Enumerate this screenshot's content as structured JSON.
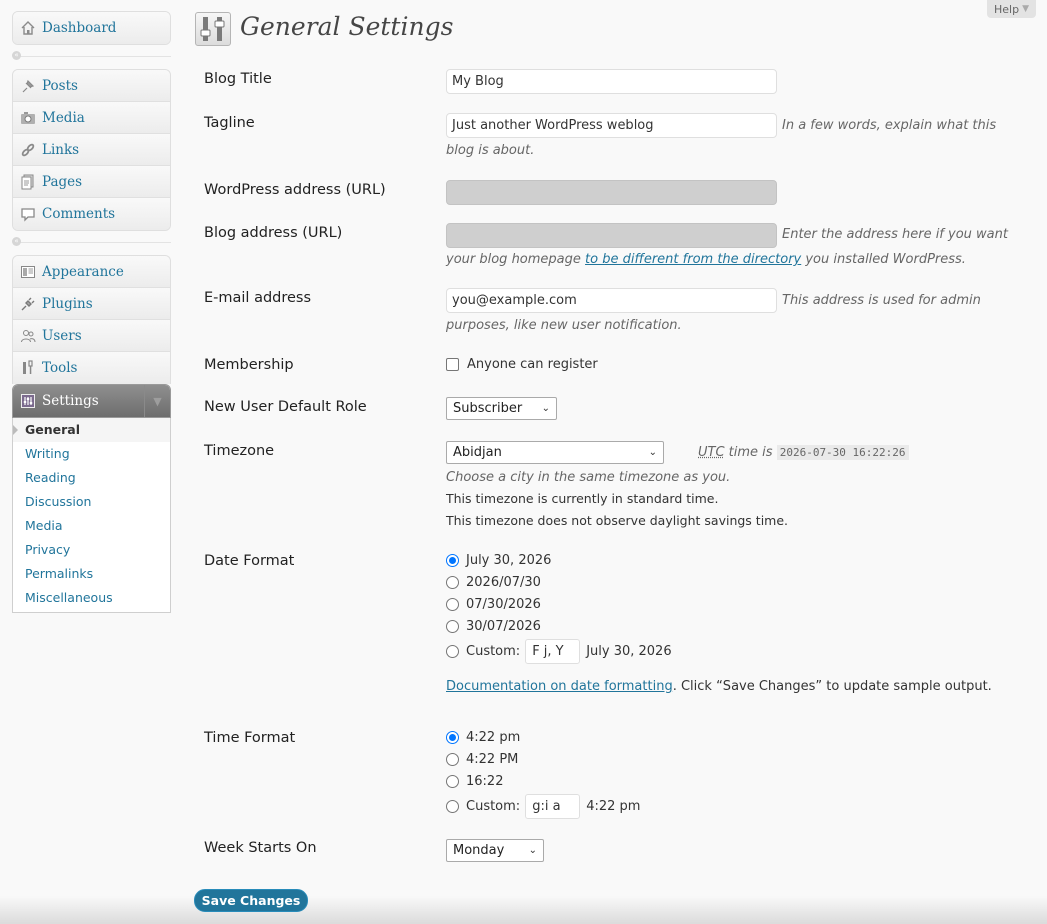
{
  "help": {
    "label": "Help"
  },
  "sidebar": {
    "group1": [
      {
        "label": "Dashboard",
        "icon": "house-icon"
      }
    ],
    "group2": [
      {
        "label": "Posts",
        "icon": "pushpin-icon"
      },
      {
        "label": "Media",
        "icon": "camera-icon"
      },
      {
        "label": "Links",
        "icon": "chain-link-icon"
      },
      {
        "label": "Pages",
        "icon": "pages-icon"
      },
      {
        "label": "Comments",
        "icon": "speech-bubble-icon"
      }
    ],
    "group3": [
      {
        "label": "Appearance",
        "icon": "layout-icon"
      },
      {
        "label": "Plugins",
        "icon": "plug-icon"
      },
      {
        "label": "Users",
        "icon": "users-icon"
      },
      {
        "label": "Tools",
        "icon": "tools-icon"
      }
    ],
    "settings": {
      "label": "Settings",
      "icon": "settings-icon"
    },
    "submenu": [
      "General",
      "Writing",
      "Reading",
      "Discussion",
      "Media",
      "Privacy",
      "Permalinks",
      "Miscellaneous"
    ]
  },
  "page": {
    "title": "General Settings"
  },
  "form": {
    "blog_title": {
      "label": "Blog Title",
      "value": "My Blog"
    },
    "tagline": {
      "label": "Tagline",
      "value": "Just another WordPress weblog",
      "desc_line1": "In a few words, explain what this",
      "desc_line2": "blog is about."
    },
    "wp_address": {
      "label": "WordPress address (URL)",
      "value": ""
    },
    "blog_address": {
      "label": "Blog address (URL)",
      "value": "",
      "desc_line1": "Enter the address here if you want",
      "desc_line2_pre": "your blog homepage ",
      "desc_link": "to be different from the directory",
      "desc_line2_post": " you installed WordPress."
    },
    "email": {
      "label": "E-mail address",
      "value": "you@example.com",
      "desc_line1": "This address is used for admin",
      "desc_line2": "purposes, like new user notification."
    },
    "membership": {
      "label": "Membership",
      "checkbox_label": "Anyone can register",
      "checked": false
    },
    "default_role": {
      "label": "New User Default Role",
      "value": "Subscriber"
    },
    "timezone": {
      "label": "Timezone",
      "value": "Abidjan",
      "utc_abbr": "UTC",
      "utc_text": " time is ",
      "utc_time": "2026-07-30 16:22:26",
      "desc": "Choose a city in the same timezone as you.",
      "note1": "This timezone is currently in standard time.",
      "note2": "This timezone does not observe daylight savings time."
    },
    "date_format": {
      "label": "Date Format",
      "options": [
        "July 30, 2026",
        "2026/07/30",
        "07/30/2026",
        "30/07/2026"
      ],
      "selected": 0,
      "custom_label": "Custom:",
      "custom_value": "F j, Y",
      "custom_preview": "July 30, 2026",
      "doc_link": "Documentation on date formatting",
      "doc_after": ". Click “Save Changes” to update sample output."
    },
    "time_format": {
      "label": "Time Format",
      "options": [
        "4:22 pm",
        "4:22 PM",
        "16:22"
      ],
      "selected": 0,
      "custom_label": "Custom:",
      "custom_value": "g:i a",
      "custom_preview": "4:22 pm"
    },
    "week_start": {
      "label": "Week Starts On",
      "value": "Monday"
    },
    "save_label": "Save Changes"
  },
  "colors": {
    "link": "#21759b",
    "radio_checked": "#0075ff",
    "active_menu": "#6d6d6d",
    "button": "#21759b"
  }
}
